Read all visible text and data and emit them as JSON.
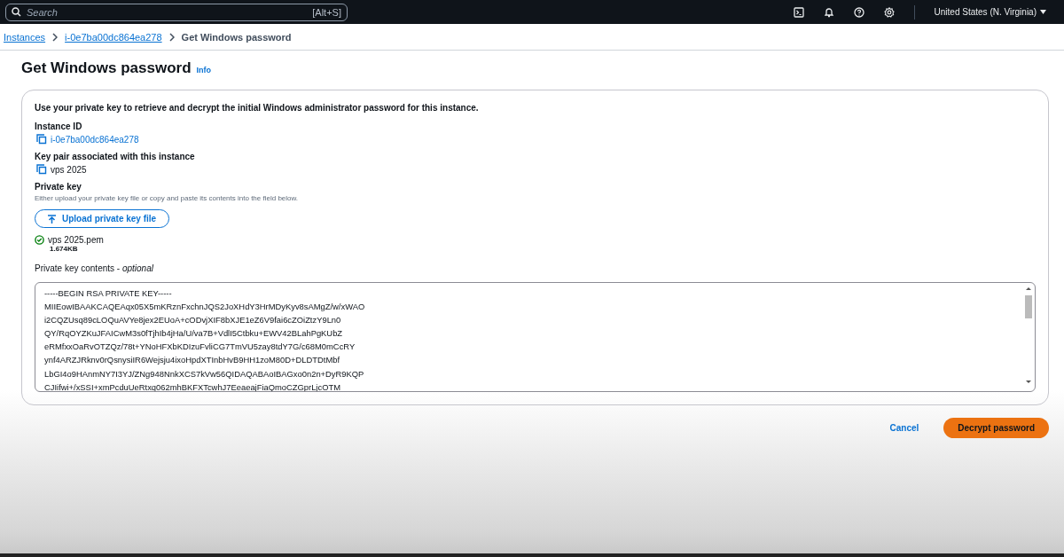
{
  "top_bar": {
    "search": {
      "placeholder": "Search",
      "shortcut": "[Alt+S]"
    },
    "region": "United States (N. Virginia)"
  },
  "breadcrumbs": [
    {
      "label": "Instances",
      "link": true
    },
    {
      "label": "i-0e7ba00dc864ea278",
      "link": true
    },
    {
      "label": "Get Windows password",
      "link": false
    }
  ],
  "page": {
    "title": "Get Windows password",
    "info": "Info"
  },
  "panel": {
    "intro": "Use your private key to retrieve and decrypt the initial Windows administrator password for this instance.",
    "fields": [
      {
        "label": "Instance ID",
        "value": "i-0e7ba00dc864ea278",
        "link": true
      },
      {
        "label": "Key pair associated with this instance",
        "value": "vps 2025",
        "link": false
      }
    ],
    "private_key": {
      "label": "Private key",
      "hint": "Either upload your private key file or copy and paste its contents into the field below.",
      "upload_button": "Upload private key file",
      "file": {
        "name": "vps 2025.pem",
        "size": "1.674KB"
      },
      "contents_label": "Private key contents - *optional*",
      "contents": [
        "-----BEGIN RSA PRIVATE KEY-----",
        "MIIEowIBAAKCAQEAqx05X5mKRznFxchnJQS2JoXHdY3HrMDyKyv8sAMgZ/w/xWAO",
        "i2CQZUsq89cLOQuAVYe8jex2EUoA+cODvjXIF8bXJE1eZ6V9fai6cZOiZtzY9Ln0",
        "QY/RqOYZKuJFAICwM3s0fTjhIb4jHa/U/va7B+VdlI5Ctbku+EWV42BLahPgKUbZ",
        "eRMfxxOaRvOTZQz/78t+YNoHFXbKDIzuFvliCG7TmVU5zay8tdY7G/c68M0mCcRY",
        "ynf4ARZJRknv0rQsnysiIR6Wejsju4ixoHpdXTInbHvB9HH1zoM80D+DLDTDtMbf",
        "LbGI4o9HAnmNY7I3YJ/ZNg948NnkXCS7kVw56QIDAQABAoIBAGxo0n2n+DyR9KQP",
        "CJIifwi+/xSSI+xmPcduUeRtxq062mhBKFXTcwhJ7EeaeajFiaQmoCZGprLjcOTM"
      ]
    }
  },
  "actions": [
    {
      "label": "Cancel",
      "kind": "link"
    },
    {
      "label": "Decrypt password",
      "kind": "primary"
    }
  ]
}
